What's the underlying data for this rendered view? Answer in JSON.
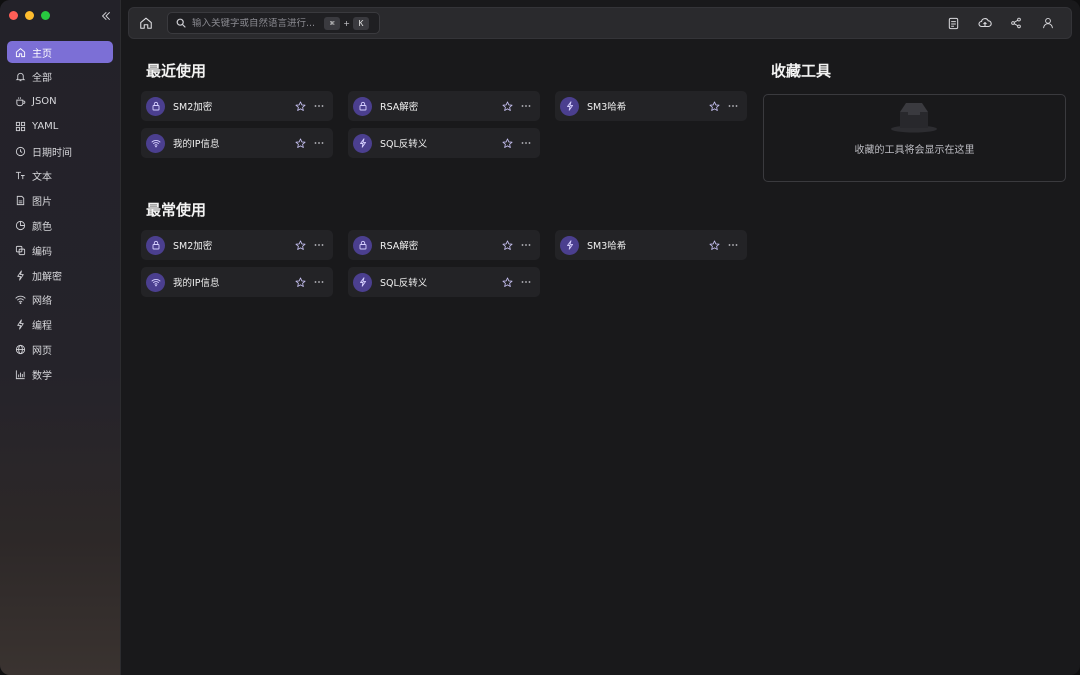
{
  "sidebar": {
    "items": [
      {
        "label": "主页",
        "icon": "home-icon",
        "active": true
      },
      {
        "label": "全部",
        "icon": "bell-icon"
      },
      {
        "label": "JSON",
        "icon": "coffee-icon"
      },
      {
        "label": "YAML",
        "icon": "grid-icon"
      },
      {
        "label": "日期时间",
        "icon": "clock-icon"
      },
      {
        "label": "文本",
        "icon": "text-icon"
      },
      {
        "label": "图片",
        "icon": "image-file-icon"
      },
      {
        "label": "颜色",
        "icon": "pie-icon"
      },
      {
        "label": "编码",
        "icon": "copy-icon"
      },
      {
        "label": "加解密",
        "icon": "bolt-icon"
      },
      {
        "label": "网络",
        "icon": "wifi-icon"
      },
      {
        "label": "编程",
        "icon": "bolt-icon"
      },
      {
        "label": "网页",
        "icon": "globe-icon"
      },
      {
        "label": "数学",
        "icon": "bar-chart-icon"
      }
    ]
  },
  "search": {
    "placeholder": "输入关键字或自然语言进行...",
    "shortcut_key1": "⌘",
    "shortcut_plus": "+",
    "shortcut_key2": "K"
  },
  "recent": {
    "title": "最近使用",
    "cards": [
      {
        "label": "SM2加密",
        "icon": "lock-icon"
      },
      {
        "label": "RSA解密",
        "icon": "lock-icon"
      },
      {
        "label": "SM3哈希",
        "icon": "bolt-icon"
      },
      {
        "label": "我的IP信息",
        "icon": "wifi-icon"
      },
      {
        "label": "SQL反转义",
        "icon": "bolt-icon"
      }
    ]
  },
  "frequent": {
    "title": "最常使用",
    "cards": [
      {
        "label": "SM2加密",
        "icon": "lock-icon"
      },
      {
        "label": "RSA解密",
        "icon": "lock-icon"
      },
      {
        "label": "SM3哈希",
        "icon": "bolt-icon"
      },
      {
        "label": "我的IP信息",
        "icon": "wifi-icon"
      },
      {
        "label": "SQL反转义",
        "icon": "bolt-icon"
      }
    ]
  },
  "favorites": {
    "title": "收藏工具",
    "empty_text": "收藏的工具将会显示在这里"
  },
  "colors": {
    "accent": "#7c6fd6",
    "badge": "#4b3f8f"
  }
}
